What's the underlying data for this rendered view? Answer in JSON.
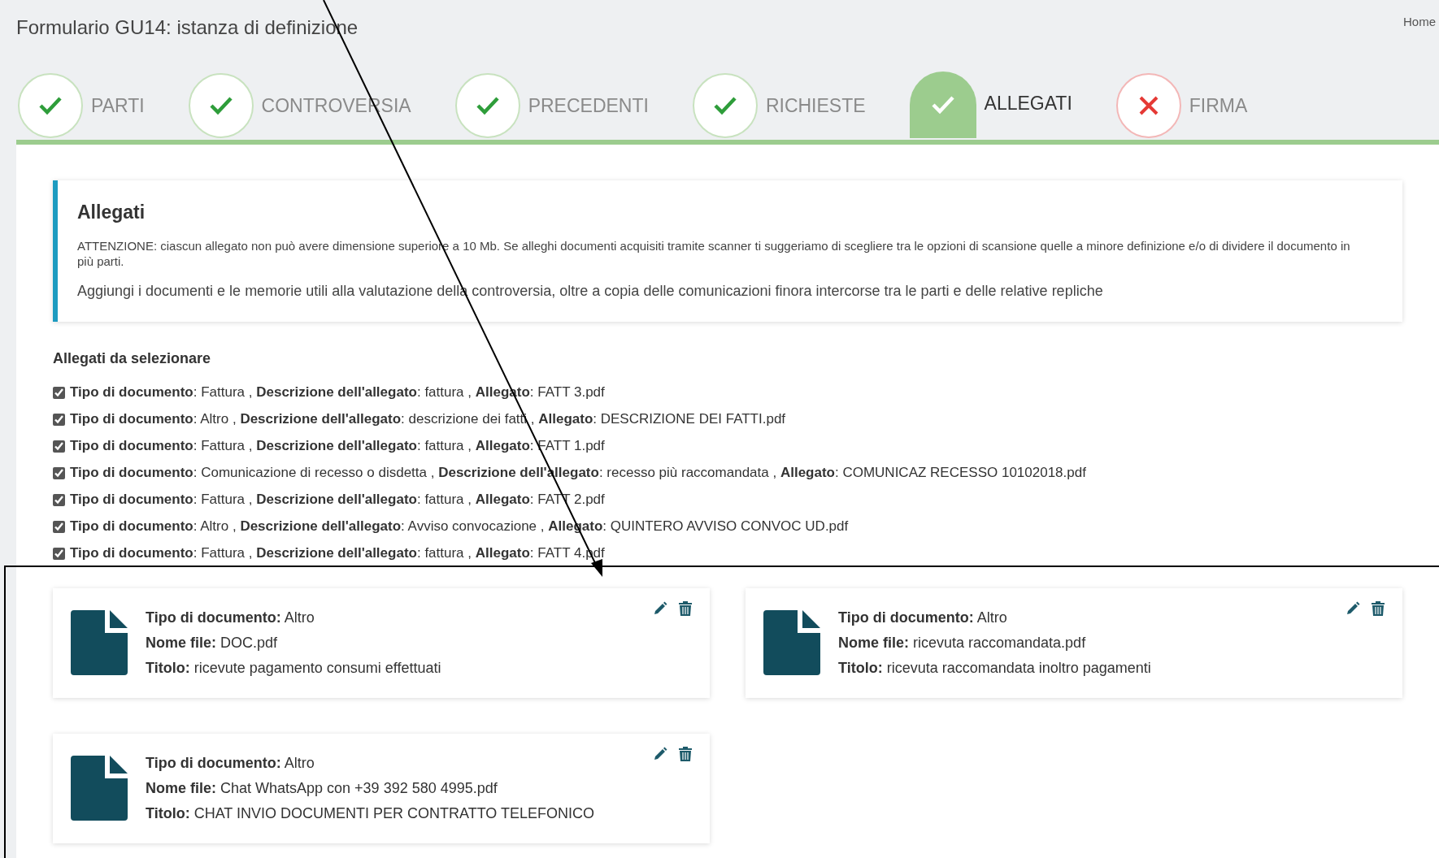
{
  "header": {
    "title": "Formulario GU14: istanza di definizione",
    "home_link": "Home"
  },
  "steps": [
    {
      "label": "PARTI",
      "kind": "done",
      "selected": false
    },
    {
      "label": "CONTROVERSIA",
      "kind": "done",
      "selected": false
    },
    {
      "label": "PRECEDENTI",
      "kind": "done",
      "selected": false
    },
    {
      "label": "RICHIESTE",
      "kind": "done",
      "selected": false
    },
    {
      "label": "ALLEGATI",
      "kind": "done",
      "selected": true
    },
    {
      "label": "FIRMA",
      "kind": "error",
      "selected": false
    }
  ],
  "info": {
    "title": "Allegati",
    "warning": "ATTENZIONE: ciascun allegato non può avere dimensione superiore a 10 Mb. Se alleghi documenti acquisiti tramite scanner ti suggeriamo di scegliere tra le opzioni di scansione quelle a minore definizione e/o di dividere il documento in più parti.",
    "text": "Aggiungi i documenti e le memorie utili alla valutazione della controversia, oltre a copia delle comunicazioni finora intercorse tra le parti e delle relative repliche"
  },
  "selection": {
    "heading": "Allegati da selezionare",
    "items": [
      {
        "text": "**Tipo di documento**: Fattura , **Descrizione dell'allegato**: fattura , **Allegato**: FATT 3.pdf",
        "checked": true
      },
      {
        "text": "**Tipo di documento**: Altro , **Descrizione dell'allegato**: descrizione dei fatti , **Allegato**: DESCRIZIONE DEI FATTI.pdf",
        "checked": true
      },
      {
        "text": "**Tipo di documento**: Fattura , **Descrizione dell'allegato**: fattura , **Allegato**: FATT 1.pdf",
        "checked": true
      },
      {
        "text": "**Tipo di documento**: Comunicazione di recesso o disdetta , **Descrizione dell'allegato**: recesso più raccomandata , **Allegato**: COMUNICAZ RECESSO 10102018.pdf",
        "checked": true
      },
      {
        "text": "**Tipo di documento**: Fattura , **Descrizione dell'allegato**: fattura , **Allegato**: FATT 2.pdf",
        "checked": true
      },
      {
        "text": "**Tipo di documento**: Altro , **Descrizione dell'allegato**: Avviso convocazione , **Allegato**: QUINTERO AVVISO CONVOC UD.pdf",
        "checked": true
      },
      {
        "text": "**Tipo di documento**: Fattura , **Descrizione dell'allegato**: fattura , **Allegato**: FATT 4.pdf",
        "checked": true
      }
    ]
  },
  "attachments": [
    {
      "lines": [
        "**Tipo di documento:** Altro",
        "**Nome file:** DOC.pdf",
        "**Titolo:** ricevute pagamento consumi effettuati"
      ]
    },
    {
      "lines": [
        "**Tipo di documento:** Altro",
        "**Nome file:** ricevuta raccomandata.pdf",
        "**Titolo:** ricevuta raccomandata inoltro pagamenti"
      ]
    },
    {
      "lines": [
        "**Tipo di documento:** Altro",
        "**Nome file:** Chat WhatsApp con +39 392 580 4995.pdf",
        "**Titolo:** CHAT INVIO DOCUMENTI PER CONTRATTO TELEFONICO"
      ]
    }
  ]
}
